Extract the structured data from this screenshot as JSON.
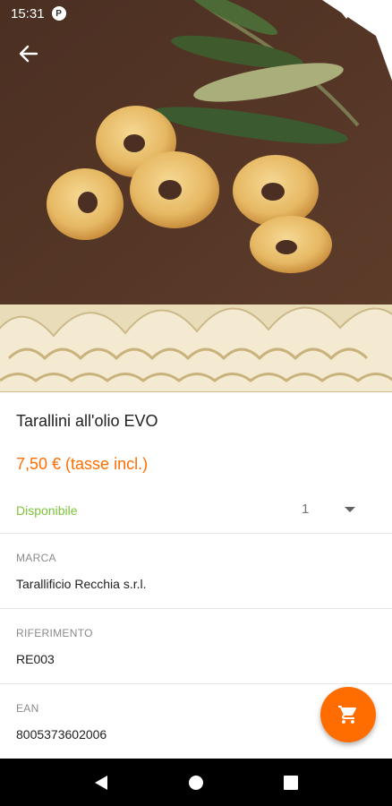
{
  "status_bar": {
    "time": "15:31",
    "notification_badge": "P",
    "icons": [
      "wifi-icon",
      "signal-icon",
      "battery-icon"
    ]
  },
  "top_bar": {
    "back_icon": "arrow-left-icon"
  },
  "hero_image": {
    "description_icon": "product-photo"
  },
  "product": {
    "title": "Tarallini all'olio EVO",
    "price": "7,50 € (tasse incl.)",
    "availability": "Disponibile",
    "quantity": "1"
  },
  "details": [
    {
      "label": "MARCA",
      "value": "Tarallificio Recchia s.r.l."
    },
    {
      "label": "RIFERIMENTO",
      "value": "RE003"
    },
    {
      "label": "EAN",
      "value": "8005373602006"
    }
  ],
  "fab": {
    "icon": "cart-icon"
  },
  "nav_bar": {
    "icons": [
      "back-triangle-icon",
      "home-circle-icon",
      "recents-square-icon"
    ]
  },
  "colors": {
    "accent": "#ff6d00",
    "available": "#7cc43a",
    "label_gray": "#8a8a8a",
    "text": "#212121"
  }
}
